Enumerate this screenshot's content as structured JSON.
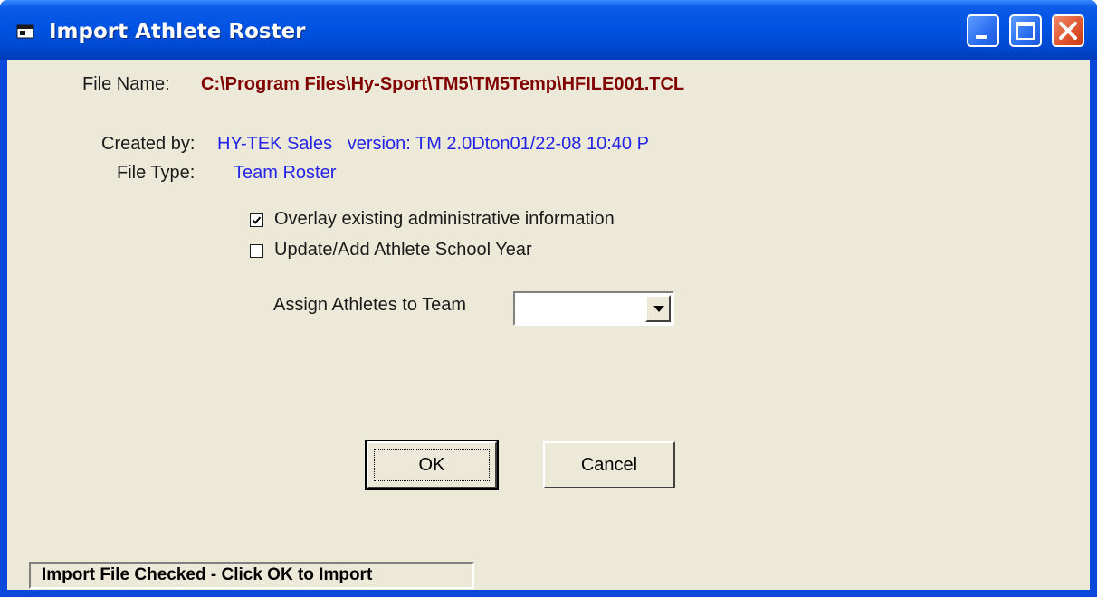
{
  "window": {
    "title": "Import Athlete Roster"
  },
  "file": {
    "name_label": "File Name:",
    "name_value": "C:\\Program Files\\Hy-Sport\\TM5\\TM5Temp\\HFILE001.TCL",
    "created_label": "Created by:",
    "created_value": "HY-TEK Sales   version: TM 2.0Dton01/22-08 10:40 P",
    "type_label": "File Type:",
    "type_value": "Team Roster"
  },
  "options": {
    "overlay_label": "Overlay existing administrative information",
    "overlay_checked": true,
    "school_year_label": "Update/Add Athlete School Year",
    "school_year_checked": false
  },
  "team": {
    "label": "Assign Athletes to Team",
    "selected": ""
  },
  "buttons": {
    "ok": "OK",
    "cancel": "Cancel"
  },
  "status": {
    "text": "Import File Checked - Click OK to Import"
  },
  "icons": {
    "app": "app-window-icon",
    "minimize": "minimize-icon",
    "maximize": "maximize-icon",
    "close": "close-icon",
    "dropdown": "chevron-down-icon",
    "check": "checkmark-icon"
  },
  "colors": {
    "titlebar": "#0054e3",
    "client_bg": "#ece9d8",
    "file_name_value": "#800000",
    "info_value": "#2424e8",
    "close_button": "#e0532e"
  }
}
